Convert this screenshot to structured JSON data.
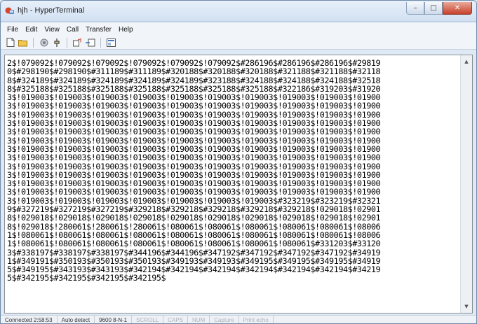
{
  "window": {
    "title": "hjh - HyperTerminal"
  },
  "caption_buttons": {
    "minimize": "–",
    "maximize": "□",
    "close": "✕"
  },
  "menubar": {
    "items": [
      "File",
      "Edit",
      "View",
      "Call",
      "Transfer",
      "Help"
    ]
  },
  "toolbar": {
    "buttons": [
      "new-document-icon",
      "open-folder-icon",
      "connect-icon",
      "disconnect-icon",
      "send-icon",
      "receive-icon",
      "properties-icon"
    ]
  },
  "terminal": {
    "lines": [
      "2$!079092$!079092$!079092$!079092$!079092$!079092$#286196$#286196$#286196$#29819",
      "0$#298190$#298190$#311189$#311189$#320188$#320188$#320188$#321188$#321188$#32118",
      "8$#324189$#324189$#324189$#324189$#324189$#323188$#324188$#324188$#324188$#32518",
      "8$#325188$#325188$#325188$#325188$#325188$#325188$#325188$#322186$#319203$#31920",
      "3$!019003$!019003$!019003$!019003$!019003$!019003$!019003$!019003$!019003$!01900",
      "3$!019003$!019003$!019003$!019003$!019003$!019003$!019003$!019003$!019003$!01900",
      "3$!019003$!019003$!019003$!019003$!019003$!019003$!019003$!019003$!019003$!01900",
      "3$!019003$!019003$!019003$!019003$!019003$!019003$!019003$!019003$!019003$!01900",
      "3$!019003$!019003$!019003$!019003$!019003$!019003$!019003$!019003$!019003$!01900",
      "3$!019003$!019003$!019003$!019003$!019003$!019003$!019003$!019003$!019003$!01900",
      "3$!019003$!019003$!019003$!019003$!019003$!019003$!019003$!019003$!019003$!01900",
      "3$!019003$!019003$!019003$!019003$!019003$!019003$!019003$!019003$!019003$!01900",
      "3$!019003$!019003$!019003$!019003$!019003$!019003$!019003$!019003$!019003$!01900",
      "3$!019003$!019003$!019003$!019003$!019003$!019003$!019003$!019003$!019003$!01900",
      "3$!019003$!019003$!019003$!019003$!019003$!019003$!019003$!019003$!019003$!01900",
      "3$!019003$!019003$!019003$!019003$!019003$!019003$!019003$!019003$!019003$!01900",
      "3$!019003$!019003$!019003$!019003$!019003$!019003$!019003$#323219$#323219$#32321",
      "9$#327219$#327219$#327219$#329218$#329218$#329218$#329218$#329218$!029018$!02901",
      "8$!029018$!029018$!029018$!029018$!029018$!029018$!029018$!029018$!029018$!02901",
      "8$!029018$!280061$!280061$!280061$!080061$!080061$!080061$!080061$!080061$!08006",
      "1$!080061$!080061$!080061$!080061$!080061$!080061$!080061$!080061$!080061$!08006",
      "1$!080061$!080061$!080061$!080061$!080061$!080061$!080061$!080061$#331203$#33120",
      "3$#338197$#338197$#338197$#344196$#344196$#347192$#347192$#347192$#347192$#34919",
      "1$#349191$#350193$#350193$#350193$#349193$#349193$#349195$#349195$#349195$#34919",
      "5$#349195$#343193$#343193$#342194$#342194$#342194$#342194$#342194$#342194$#34219",
      "5$#342195$#342195$#342195$#342195$"
    ]
  },
  "statusbar": {
    "connected": "Connected 2:58:53",
    "detect": "Auto detect",
    "settings": "9600 8-N-1",
    "scroll": "SCROLL",
    "caps": "CAPS",
    "num": "NUM",
    "capture": "Capture",
    "print_echo": "Print echo"
  }
}
